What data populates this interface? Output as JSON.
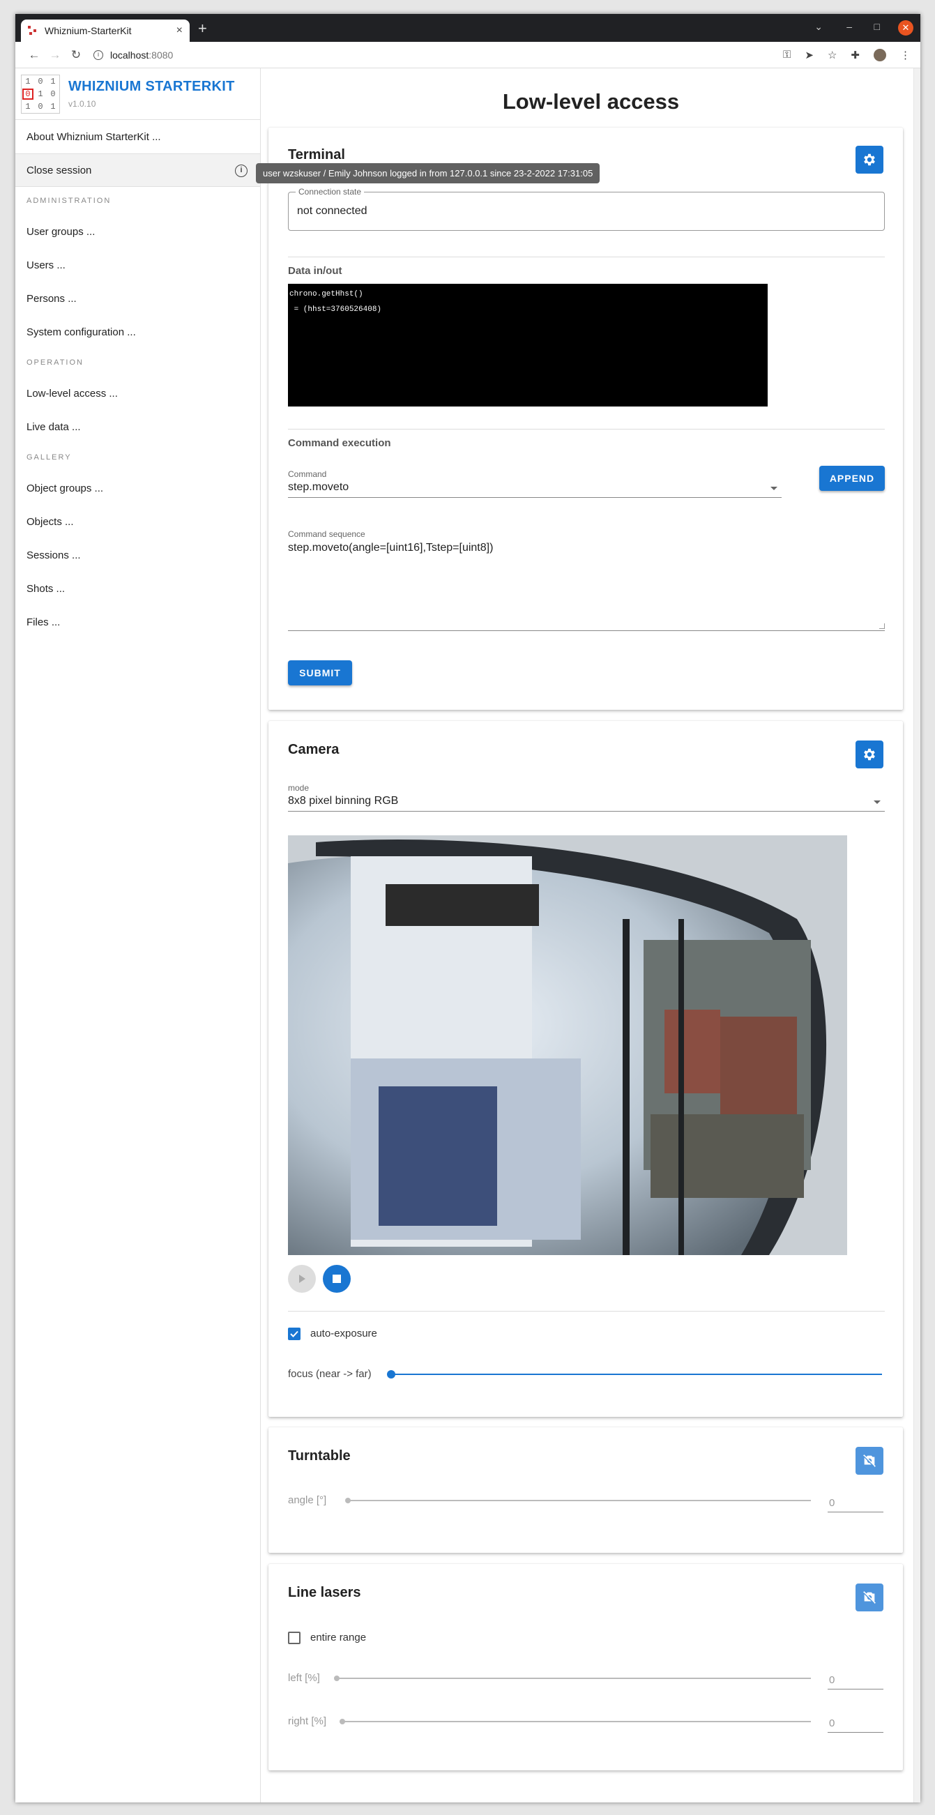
{
  "browser": {
    "tab_title": "Whiznium-StarterKit",
    "tab_close": "×",
    "new_tab": "+",
    "url_host": "localhost",
    "url_port": ":8080"
  },
  "sidebar": {
    "brand_name": "WHIZNIUM STARTERKIT",
    "version": "v1.0.10",
    "logo_digits": [
      "1",
      "0",
      "1",
      "0",
      "1",
      "0",
      "1",
      "0",
      "1"
    ],
    "about": "About Whiznium StarterKit ...",
    "close_session": "Close session",
    "sections": [
      {
        "heading": "ADMINISTRATION",
        "items": [
          "User groups ...",
          "Users ...",
          "Persons ...",
          "System configuration ..."
        ]
      },
      {
        "heading": "OPERATION",
        "items": [
          "Low-level access ...",
          "Live data ..."
        ]
      },
      {
        "heading": "GALLERY",
        "items": [
          "Object groups ...",
          "Objects ...",
          "Sessions ...",
          "Shots ...",
          "Files ..."
        ]
      }
    ]
  },
  "tooltip": "user wzskuser / Emily Johnson logged in from 127.0.0.1 since 23-2-2022 17:31:05",
  "main": {
    "page_title": "Low-level access",
    "terminal": {
      "title": "Terminal",
      "connection_label": "Connection state",
      "connection_value": "not connected",
      "data_title": "Data in/out",
      "console_lines": "chrono.getHhst()\n = (hhst=3760526408)",
      "command_title": "Command execution",
      "command_label": "Command",
      "command_value": "step.moveto",
      "append_label": "APPEND",
      "sequence_label": "Command sequence",
      "sequence_value": "step.moveto(angle=[uint16],Tstep=[uint8])",
      "submit_label": "SUBMIT"
    },
    "camera": {
      "title": "Camera",
      "mode_label": "mode",
      "mode_value": "8x8 pixel binning RGB",
      "auto_exposure_label": "auto-exposure",
      "auto_exposure_checked": true,
      "focus_label": "focus (near -> far)",
      "focus_value": 0
    },
    "turntable": {
      "title": "Turntable",
      "angle_label": "angle [°]",
      "angle_value": "0"
    },
    "line_lasers": {
      "title": "Line lasers",
      "entire_range_label": "entire range",
      "entire_range_checked": false,
      "left_label": "left [%]",
      "left_value": "0",
      "right_label": "right [%]",
      "right_value": "0"
    }
  },
  "colors": {
    "primary": "#1976d2",
    "close_button": "#e95420"
  },
  "icons": [
    "back-icon",
    "forward-icon",
    "reload-icon",
    "info-icon",
    "key-icon",
    "send-icon",
    "star-icon",
    "extensions-icon",
    "menu-icon",
    "gear-icon",
    "camera-off-icon",
    "play-icon",
    "stop-icon"
  ]
}
